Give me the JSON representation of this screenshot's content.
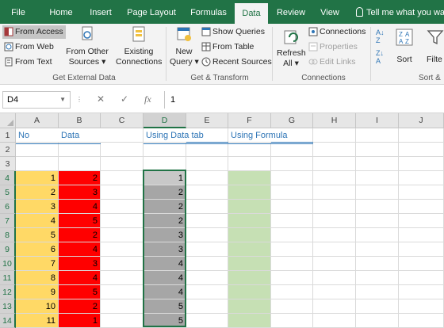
{
  "tabs": [
    "File",
    "Home",
    "Insert",
    "Page Layout",
    "Formulas",
    "Data",
    "Review",
    "View"
  ],
  "tell_me": "Tell me what you wa",
  "ribbon": {
    "from_access": "From Access",
    "from_web": "From Web",
    "from_text": "From Text",
    "from_other_1": "From Other",
    "from_other_2": "Sources",
    "existing_1": "Existing",
    "existing_2": "Connections",
    "new_query_1": "New",
    "new_query_2": "Query",
    "show_queries": "Show Queries",
    "from_table": "From Table",
    "recent_sources": "Recent Sources",
    "refresh_1": "Refresh",
    "refresh_2": "All",
    "connections": "Connections",
    "properties": "Properties",
    "edit_links": "Edit Links",
    "sort": "Sort",
    "filter": "Filte",
    "group_external": "Get External Data",
    "group_transform": "Get & Transform",
    "group_connections": "Connections",
    "group_sort": "Sort &"
  },
  "formula_bar": {
    "name_box": "D4",
    "value": "1",
    "fx": "fx"
  },
  "colors": {
    "excel_green": "#217346",
    "yellow": "#ffd966",
    "red": "#ff0000",
    "gray_fill": "#a6a6a6",
    "light_green": "#c6e0b4",
    "header_blue": "#2e75b6"
  },
  "columns": [
    "A",
    "B",
    "C",
    "D",
    "E",
    "F",
    "G",
    "H",
    "I",
    "J"
  ],
  "rows": [
    "1",
    "2",
    "3",
    "4",
    "5",
    "6",
    "7",
    "8",
    "9",
    "10",
    "11",
    "12",
    "13",
    "14"
  ],
  "headers": {
    "a": "No",
    "b": "Data",
    "d": "Using Data tab",
    "f": "Using Formula"
  },
  "col_a": [
    "1",
    "2",
    "3",
    "4",
    "5",
    "6",
    "7",
    "8",
    "9",
    "10",
    "11"
  ],
  "col_b": [
    "2",
    "3",
    "4",
    "5",
    "2",
    "4",
    "3",
    "4",
    "5",
    "2",
    "1"
  ],
  "col_d": [
    "1",
    "2",
    "2",
    "2",
    "3",
    "3",
    "4",
    "4",
    "4",
    "5",
    "5"
  ]
}
